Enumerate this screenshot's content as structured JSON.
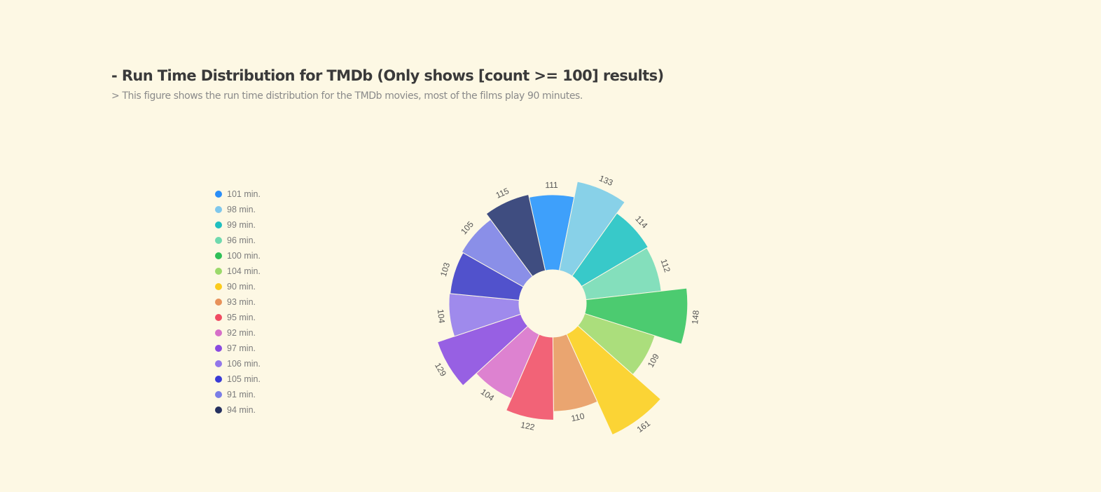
{
  "header": {
    "title": "- Run Time Distribution for TMDb (Only shows [count >= 100] results)",
    "subtitle": "> This figure shows the run time distribution for the TMDb movies, most of the films play 90 minutes."
  },
  "chart_data": {
    "type": "nightingale-rose",
    "unit": "min.",
    "slices": [
      {
        "name": "101 min.",
        "value": 111,
        "color": "#3ea0fb"
      },
      {
        "name": "98 min.",
        "value": 133,
        "color": "#88d1e8"
      },
      {
        "name": "99 min.",
        "value": 114,
        "color": "#38c9c9"
      },
      {
        "name": "96 min.",
        "value": 112,
        "color": "#84dfbc"
      },
      {
        "name": "100 min.",
        "value": 148,
        "color": "#4ccb70"
      },
      {
        "name": "104 min.",
        "value": 109,
        "color": "#abde7c"
      },
      {
        "name": "90 min.",
        "value": 161,
        "color": "#fbd435"
      },
      {
        "name": "93 min.",
        "value": 110,
        "color": "#eaa570"
      },
      {
        "name": "95 min.",
        "value": 122,
        "color": "#f26377"
      },
      {
        "name": "92 min.",
        "value": 104,
        "color": "#dd82d0"
      },
      {
        "name": "97 min.",
        "value": 129,
        "color": "#9760e3"
      },
      {
        "name": "106 min.",
        "value": 104,
        "color": "#9f8aec"
      },
      {
        "name": "105 min.",
        "value": 103,
        "color": "#5152cc"
      },
      {
        "name": "91 min.",
        "value": 105,
        "color": "#8a8fe8"
      },
      {
        "name": "94 min.",
        "value": 115,
        "color": "#3f4d80"
      }
    ],
    "legend_dot_colors": [
      "#2a8ef8",
      "#7fc7ec",
      "#1fbfbf",
      "#6fd9ae",
      "#2fbf57",
      "#9bd96a",
      "#fbcb1b",
      "#e8925a",
      "#f04b62",
      "#d66fc8",
      "#8a4ae0",
      "#9277ea",
      "#3a3bd6",
      "#7a7ee6",
      "#25305f"
    ],
    "legend_position": "left"
  }
}
